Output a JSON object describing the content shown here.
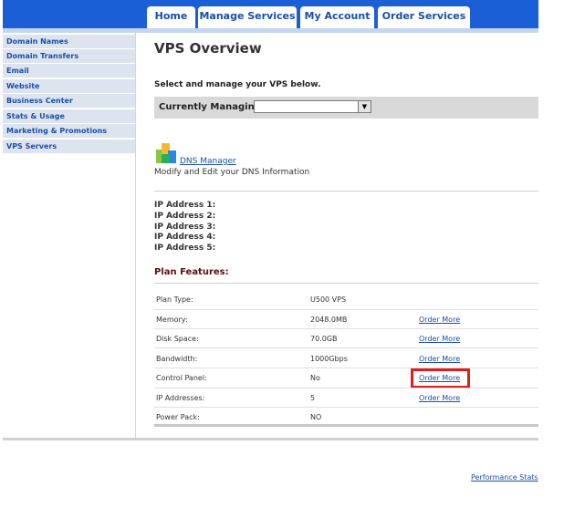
{
  "tabs": [
    {
      "label": "Home"
    },
    {
      "label": "Manage Services"
    },
    {
      "label": "My Account"
    },
    {
      "label": "Order Services"
    }
  ],
  "sidebar": {
    "items": [
      {
        "label": "Domain Names"
      },
      {
        "label": "Domain Transfers"
      },
      {
        "label": "Email"
      },
      {
        "label": "Website"
      },
      {
        "label": "Business Center"
      },
      {
        "label": "Stats & Usage"
      },
      {
        "label": "Marketing & Promotions"
      },
      {
        "label": "VPS Servers"
      }
    ]
  },
  "main": {
    "title": "VPS Overview",
    "subtitle": "Select and manage your VPS below.",
    "managing_label": "Currently Managing",
    "managing_value": "",
    "dns_link": "DNS Manager",
    "dns_desc": "Modify and Edit your DNS Information",
    "ip_labels": [
      "IP Address 1:",
      "IP Address 2:",
      "IP Address 3:",
      "IP Address 4:",
      "IP Address 5:"
    ],
    "plan_heading": "Plan Features:",
    "features": [
      {
        "label": "Plan Type:",
        "value": "U500 VPS",
        "link": ""
      },
      {
        "label": "Memory:",
        "value": "2048.0MB",
        "link": "Order More"
      },
      {
        "label": "Disk Space:",
        "value": "70.0GB",
        "link": "Order More"
      },
      {
        "label": "Bandwidth:",
        "value": "1000Gbps",
        "link": "Order More"
      },
      {
        "label": "Control Panel:",
        "value": "No",
        "link": "Order More"
      },
      {
        "label": "IP Addresses:",
        "value": "5",
        "link": "Order More"
      },
      {
        "label": "Power Pack:",
        "value": "NO",
        "link": ""
      }
    ]
  },
  "footer": {
    "performance_link": "Performance Stats"
  },
  "colors": {
    "topbar": "#1a5fd6",
    "link": "#1a4fa8",
    "highlight": "#e11c1c",
    "heading": "#5a0e0e"
  },
  "icons": {
    "dns": "dns-manager-icon"
  }
}
